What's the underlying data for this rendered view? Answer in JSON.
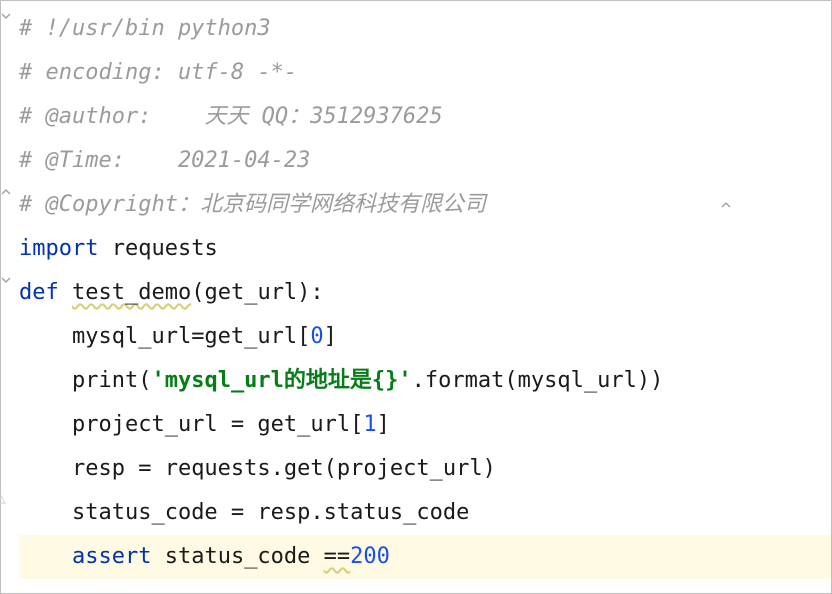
{
  "code": {
    "line1": {
      "comment": "# !/usr/bin python3"
    },
    "line2": {
      "comment": "# encoding: utf-8 -*-"
    },
    "line3": {
      "prefix": "# @author:    ",
      "rest": "天天 QQ：3512937625"
    },
    "line4": {
      "comment": "# @Time:    2021-04-23"
    },
    "line5": {
      "prefix": "# @Copyright：",
      "rest": "北京码同学网络科技有限公司"
    },
    "line6": {
      "kw": "import",
      "sp": " ",
      "mod": "requests"
    },
    "line7": {
      "kw": "def",
      "sp": " ",
      "name": "test_demo",
      "args": "(get_url):"
    },
    "line8": {
      "indent": "    ",
      "text1": "mysql_url=get_url[",
      "num": "0",
      "text2": "]"
    },
    "line9": {
      "indent": "    ",
      "fn": "print",
      "text1": "(",
      "str": "'mysql_url的地址是{}'",
      "text2": ".format(mysql_url))"
    },
    "line10": {
      "indent": "    ",
      "text1": "project_url = get_url[",
      "num": "1",
      "text2": "]"
    },
    "line11": {
      "indent": "    ",
      "text": "resp = requests.get(project_url)"
    },
    "line12": {
      "indent": "    ",
      "text": "status_code = resp.status_code"
    },
    "line13": {
      "indent": "    ",
      "kw": "assert",
      "sp": " ",
      "text1": "status_code ",
      "op": "==",
      "num": "200"
    }
  }
}
